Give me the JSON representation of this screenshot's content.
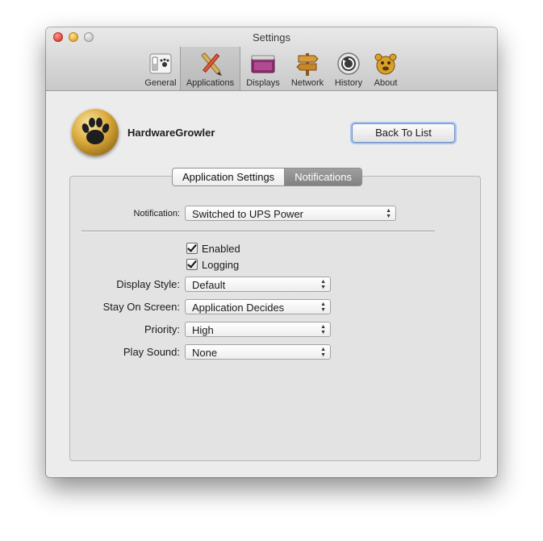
{
  "window": {
    "title": "Settings"
  },
  "toolbar": {
    "items": [
      {
        "label": "General",
        "icon": "general-switch-icon"
      },
      {
        "label": "Applications",
        "icon": "applications-tools-icon"
      },
      {
        "label": "Displays",
        "icon": "displays-window-icon"
      },
      {
        "label": "Network",
        "icon": "network-signpost-icon"
      },
      {
        "label": "History",
        "icon": "history-clock-icon"
      },
      {
        "label": "About",
        "icon": "about-growl-icon"
      }
    ],
    "selected": "Applications"
  },
  "app": {
    "name": "HardwareGrowler",
    "back_label": "Back To List"
  },
  "tabs": {
    "app_settings": "Application Settings",
    "notifications": "Notifications",
    "selected": "Notifications"
  },
  "notification": {
    "label": "Notification:",
    "value": "Switched to UPS Power"
  },
  "checks": {
    "enabled": "Enabled",
    "logging": "Logging"
  },
  "fields": {
    "display_style": {
      "label": "Display Style:",
      "value": "Default"
    },
    "stay_on_screen": {
      "label": "Stay On Screen:",
      "value": "Application Decides"
    },
    "priority": {
      "label": "Priority:",
      "value": "High"
    },
    "play_sound": {
      "label": "Play Sound:",
      "value": "None"
    }
  },
  "colors": {
    "accent": "#6e8fc3",
    "selected_tab": "#8f8f8f",
    "app_icon_gold": "#d9a83a"
  }
}
